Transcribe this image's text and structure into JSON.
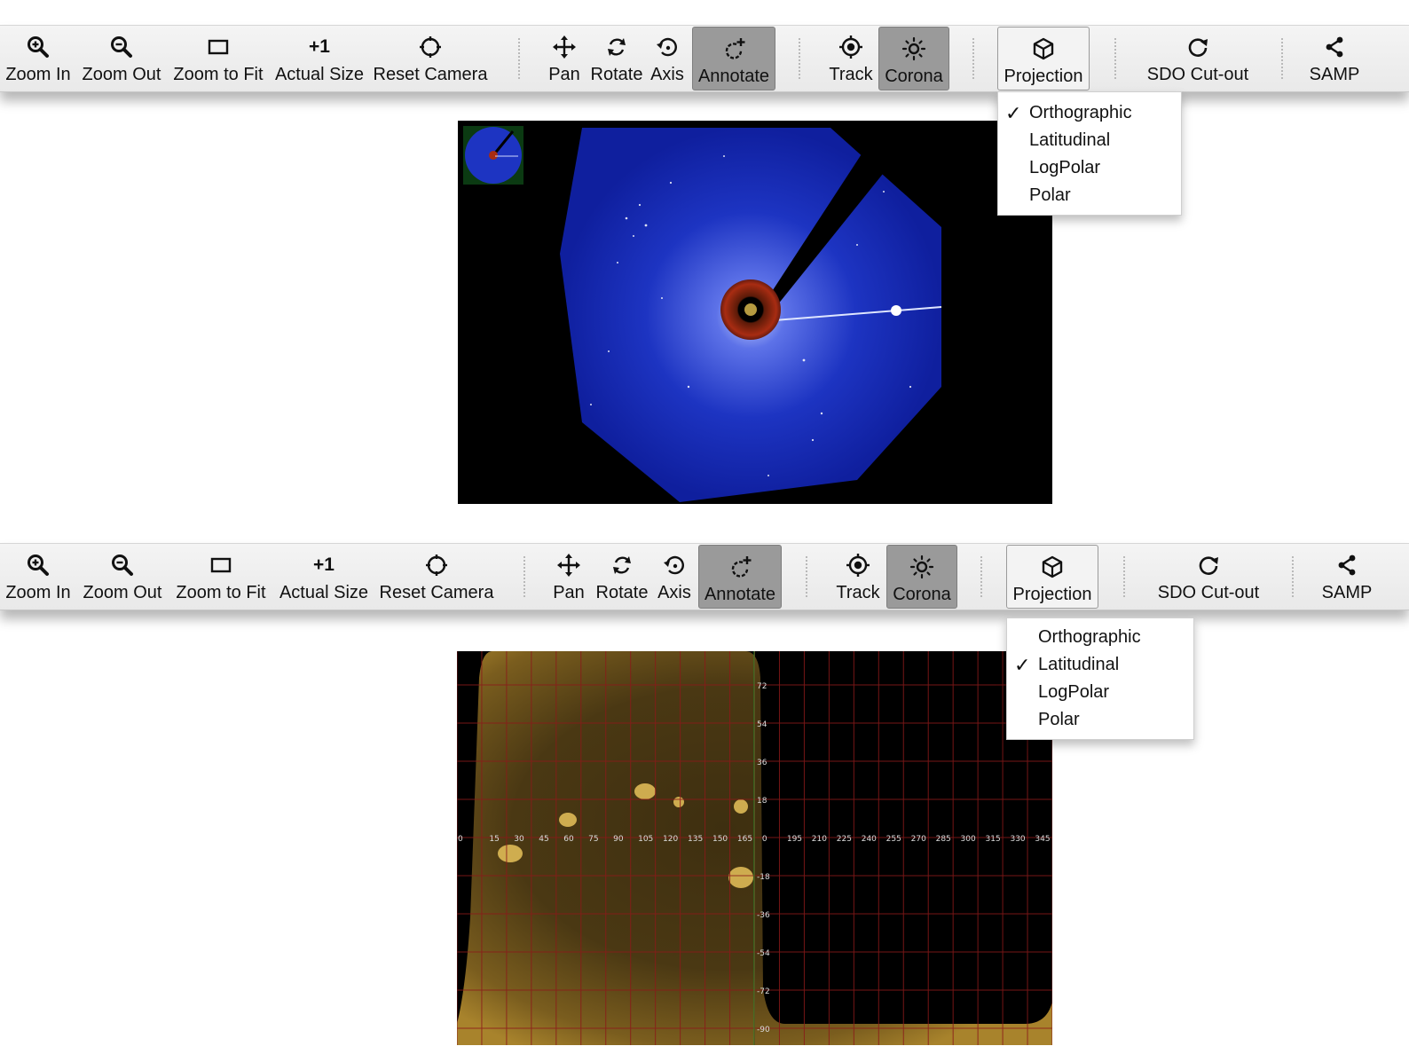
{
  "toolbar": {
    "zoom_in": "Zoom In",
    "zoom_out": "Zoom Out",
    "zoom_fit": "Zoom to Fit",
    "actual_size": "Actual Size",
    "actual_size_icon_text": "+1",
    "reset_camera": "Reset Camera",
    "pan": "Pan",
    "rotate": "Rotate",
    "axis": "Axis",
    "annotate": "Annotate",
    "track": "Track",
    "corona": "Corona",
    "projection": "Projection",
    "sdo_cutout": "SDO Cut-out",
    "samp": "SAMP"
  },
  "projection_menu": {
    "options": [
      "Orthographic",
      "Latitudinal",
      "LogPolar",
      "Polar"
    ],
    "check_mark": "✓"
  },
  "panel1": {
    "selected_projection": "Orthographic"
  },
  "panel2": {
    "selected_projection": "Latitudinal",
    "longitude_labels": [
      "0",
      "15",
      "30",
      "45",
      "60",
      "75",
      "90",
      "105",
      "120",
      "135",
      "150",
      "165",
      "0",
      "195",
      "210",
      "225",
      "240",
      "255",
      "270",
      "285",
      "300",
      "315",
      "330",
      "345"
    ],
    "latitude_labels": [
      "72",
      "54",
      "36",
      "18",
      "-18",
      "-36",
      "-54",
      "-72",
      "-90"
    ]
  },
  "colors": {
    "active_button": "#9a9a9a",
    "coronagraph_blue": "#1a2fb0",
    "sun_gold": "#8a6a1c",
    "grid_red": "#8b1a1a"
  },
  "icons": {
    "zoom_in": "zoom-in-icon",
    "zoom_out": "zoom-out-icon",
    "zoom_fit": "rectangle-icon",
    "reset_camera": "crosshair-icon",
    "pan": "move-arrows-icon",
    "rotate": "rotate-icon",
    "axis": "axis-rotate-icon",
    "annotate": "annotate-icon",
    "track": "target-icon",
    "corona": "sun-icon",
    "projection": "cube-icon",
    "sdo_cutout": "refresh-circle-icon",
    "samp": "share-icon"
  }
}
